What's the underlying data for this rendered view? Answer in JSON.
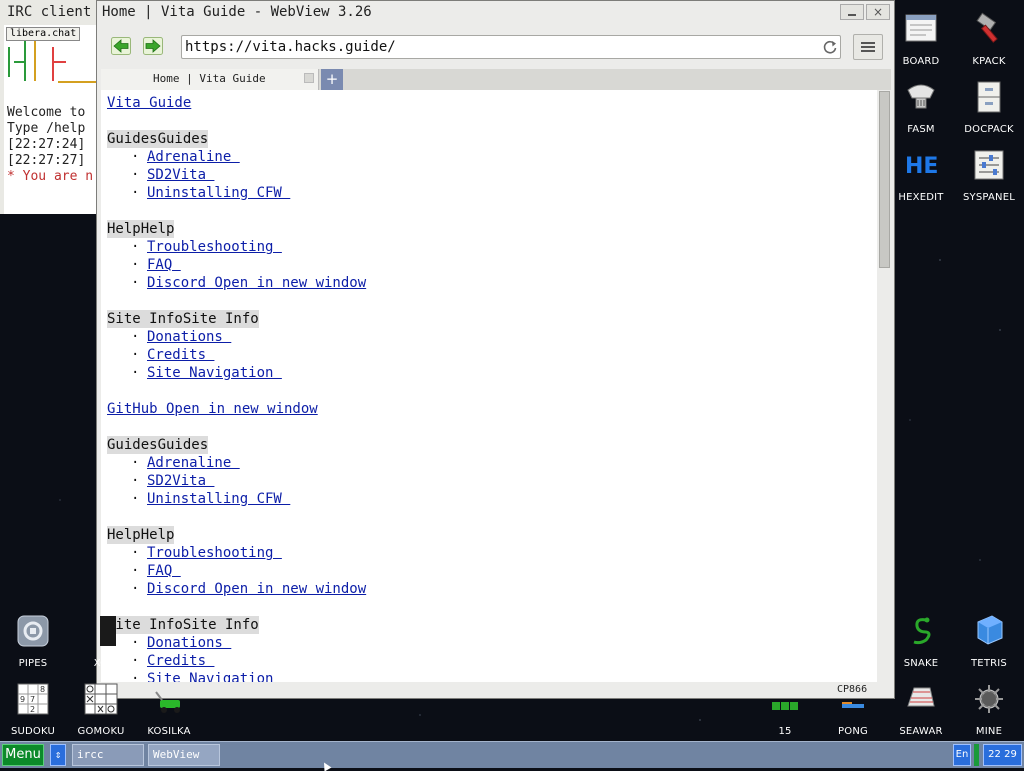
{
  "irc": {
    "title": "IRC client",
    "server_tab": "libera.chat",
    "messages": [
      "Welcome to",
      "Type /help",
      "[22:27:24]",
      "[22:27:27]"
    ],
    "warning": "* You are n"
  },
  "browser": {
    "title": "Home | Vita Guide - WebView 3.26",
    "close_glyph": "×",
    "url": "https://vita.hacks.guide/",
    "tab_label": "Home | Vita Guide",
    "new_tab_glyph": "+",
    "encoding": "CP866",
    "page": {
      "site_title": "Vita Guide",
      "sections": [
        {
          "heading": "GuidesGuides",
          "links": [
            "Adrenaline ",
            "SD2Vita ",
            "Uninstalling CFW "
          ]
        },
        {
          "heading": "HelpHelp",
          "links": [
            "Troubleshooting ",
            "FAQ ",
            "Discord Open in new window"
          ]
        },
        {
          "heading": "Site InfoSite Info",
          "links": [
            "Donations ",
            "Credits ",
            "Site Navigation "
          ]
        }
      ],
      "github_link": "GitHub Open in new window",
      "sections_repeat": [
        {
          "heading": "GuidesGuides",
          "links": [
            "Adrenaline ",
            "SD2Vita ",
            "Uninstalling CFW "
          ]
        },
        {
          "heading": "HelpHelp",
          "links": [
            "Troubleshooting ",
            "FAQ ",
            "Discord Open in new window"
          ]
        },
        {
          "heading": "Site InfoSite Info",
          "links": [
            "Donations ",
            "Credits ",
            "Site Navigation "
          ]
        }
      ]
    }
  },
  "desktop_icons": {
    "board": "BOARD",
    "kpack": "KPACK",
    "fasm": "FASM",
    "docpack": "DOCPACK",
    "hexedit": "HEXEDIT",
    "syspanel": "SYSPANEL",
    "pipes": "PIPES",
    "xo": "XO",
    "sudoku": "SUDOKU",
    "gomoku": "GOMOKU",
    "kosilka": "KOSILKA",
    "fifteen": "15",
    "pong": "PONG",
    "seawar": "SEAWAR",
    "mine": "MINE",
    "snake": "SNAKE",
    "tetris": "TETRIS",
    "hexedit_glyph": "HE",
    "sudoku_digits": [
      "8",
      "9",
      "7",
      "2"
    ]
  },
  "taskbar": {
    "menu_label": "Menu",
    "arrows_glyph": "⇕",
    "tasks": [
      "ircc",
      "WebView"
    ],
    "lang": "En",
    "clock": "22 29"
  }
}
